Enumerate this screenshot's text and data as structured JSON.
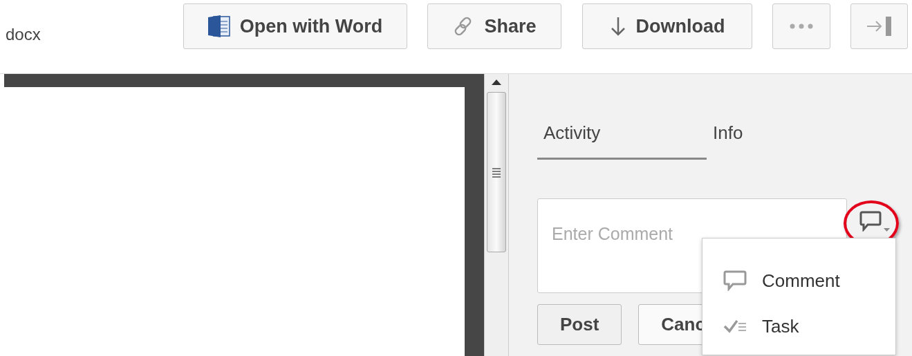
{
  "file_label": "docx",
  "toolbar": [
    {
      "kind": "word",
      "label": "Open with Word"
    },
    {
      "kind": "share",
      "label": "Share"
    },
    {
      "kind": "download",
      "label": "Download"
    },
    {
      "kind": "more"
    },
    {
      "kind": "collapse"
    }
  ],
  "tabs": [
    {
      "label": "Activity",
      "selected": true
    },
    {
      "label": "Info",
      "selected": false
    }
  ],
  "comment": {
    "placeholder": "Enter Comment"
  },
  "actions": [
    "Post",
    "Canc"
  ],
  "type_menu": {
    "expanded": true,
    "items": [
      {
        "kind": "comment",
        "label": "Comment"
      },
      {
        "kind": "task",
        "label": "Task"
      }
    ]
  }
}
